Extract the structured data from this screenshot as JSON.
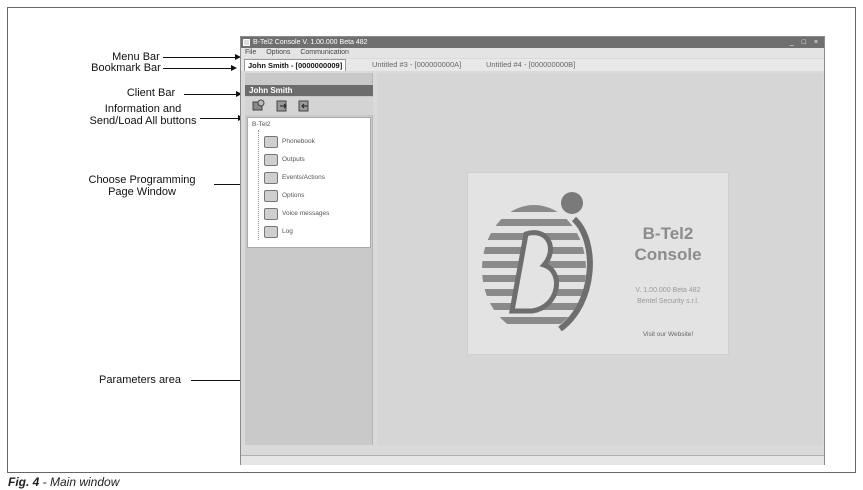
{
  "annotations": {
    "menu_bar": "Menu Bar",
    "bookmark_bar": "Bookmark Bar",
    "client_bar": "Client Bar",
    "info_buttons_line1": "Information and",
    "info_buttons_line2": "Send/Load All buttons",
    "choose_page_line1": "Choose Programming",
    "choose_page_line2": "Page Window",
    "parameters_area": "Parameters area"
  },
  "window": {
    "title": "B-Tel2 Console V. 1.00.000 Beta 482",
    "controls": "_ □ ×"
  },
  "menu": {
    "items": [
      "File",
      "Options",
      "Communication"
    ]
  },
  "tabs": [
    {
      "label": "John Smith - [0000000009]"
    },
    {
      "label": "Untitled #3 - [000000000A]"
    },
    {
      "label": "Untitled #4 - [000000000B]"
    }
  ],
  "client": {
    "name": "John Smith"
  },
  "tree": {
    "root": "B-Tel2",
    "items": [
      {
        "label": "Phonebook",
        "icon": "phonebook-icon"
      },
      {
        "label": "Outputs",
        "icon": "outputs-icon"
      },
      {
        "label": "Events/Actions",
        "icon": "events-icon"
      },
      {
        "label": "Options",
        "icon": "options-icon"
      },
      {
        "label": "Voice messages",
        "icon": "voice-icon"
      },
      {
        "label": "Log",
        "icon": "log-icon"
      }
    ]
  },
  "splash": {
    "product_line1": "B-Tel2",
    "product_line2": "Console",
    "version": "V. 1.00.000 Beta 482",
    "company": "Bentel Security s.r.l.",
    "link": "Visit our Website!"
  },
  "caption": {
    "fig": "Fig. 4",
    "text": " - Main window"
  }
}
